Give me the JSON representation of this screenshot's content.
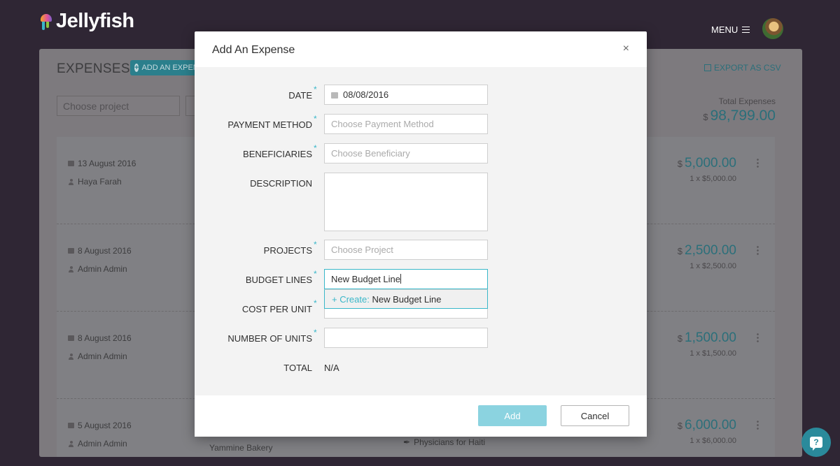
{
  "app": {
    "name": "Jellyfish",
    "menu_label": "MENU"
  },
  "background": {
    "title": "EXPENSES",
    "add_button": "ADD AN EXPENSE",
    "export_label": "EXPORT AS CSV",
    "filter_project_placeholder": "Choose project",
    "total_label": "Total Expenses",
    "total_currency": "$",
    "total_value": "98,799.00",
    "rows": [
      {
        "date": "13 August 2016",
        "person": "Haya Farah",
        "currency": "$",
        "amount": "5,000.00",
        "unit": "1 x $5,000.00"
      },
      {
        "date": "8 August 2016",
        "person": "Admin Admin",
        "currency": "$",
        "amount": "2,500.00",
        "unit": "1 x $2,500.00"
      },
      {
        "date": "8 August 2016",
        "person": "Admin Admin",
        "currency": "$",
        "amount": "1,500.00",
        "unit": "1 x $1,500.00"
      },
      {
        "date": "5 August 2016",
        "person": "Admin Admin",
        "currency": "$",
        "amount": "6,000.00",
        "unit": "1 x $6,000.00",
        "vendor": "Yammine Bakery",
        "project": "Physicians for Haiti"
      }
    ]
  },
  "modal": {
    "title": "Add An Expense",
    "close_glyph": "×",
    "required_mark": "*",
    "fields": {
      "date": {
        "label": "DATE",
        "value": "08/08/2016"
      },
      "payment_method": {
        "label": "PAYMENT METHOD",
        "placeholder": "Choose Payment Method"
      },
      "beneficiaries": {
        "label": "BENEFICIARIES",
        "placeholder": "Choose Beneficiary"
      },
      "description": {
        "label": "DESCRIPTION",
        "value": ""
      },
      "projects": {
        "label": "PROJECTS",
        "placeholder": "Choose Project"
      },
      "budget_lines": {
        "label": "BUDGET LINES",
        "value": "New Budget Line"
      },
      "cost_per_unit": {
        "label": "COST PER UNIT"
      },
      "number_of_units": {
        "label": "NUMBER OF UNITS",
        "value": ""
      },
      "total": {
        "label": "TOTAL",
        "value": "N/A"
      }
    },
    "dropdown": {
      "create_prefix": "+ Create:",
      "create_value": "New Budget Line"
    },
    "add_button": "Add",
    "cancel_button": "Cancel"
  },
  "help": {
    "glyph": "?"
  },
  "colors": {
    "accent": "#39b7c9",
    "teal_dark": "#2b6f7a",
    "add_disabled": "#8bd3e0",
    "backdrop": "#2f2634"
  }
}
